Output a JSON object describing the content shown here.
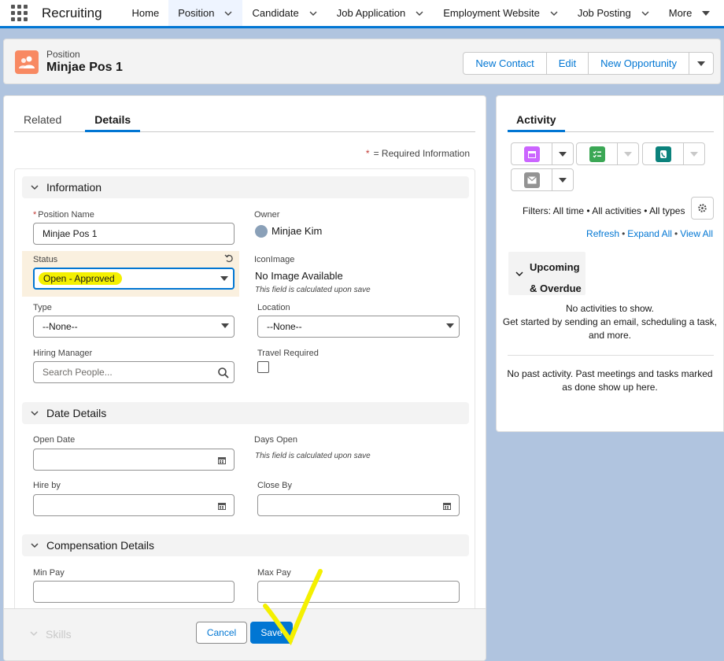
{
  "app": {
    "name": "Recruiting",
    "nav": [
      {
        "label": "Home",
        "dropdown": false
      },
      {
        "label": "Position",
        "dropdown": true,
        "active": true
      },
      {
        "label": "Candidate",
        "dropdown": true
      },
      {
        "label": "Job Application",
        "dropdown": true
      },
      {
        "label": "Employment Website",
        "dropdown": true
      },
      {
        "label": "Job Posting",
        "dropdown": true
      },
      {
        "label": "More",
        "dropdown": true
      }
    ]
  },
  "record": {
    "type": "Position",
    "title": "Minjae Pos 1",
    "actions": [
      "New Contact",
      "Edit",
      "New Opportunity"
    ]
  },
  "tabs": {
    "related": "Related",
    "details": "Details"
  },
  "required_info": "= Required Information",
  "sections": {
    "information": "Information",
    "date_details": "Date Details",
    "compensation": "Compensation Details",
    "skills": "Skills"
  },
  "fields": {
    "position_name": {
      "label": "Position Name",
      "value": "Minjae Pos 1"
    },
    "owner": {
      "label": "Owner",
      "value": "Minjae Kim"
    },
    "status": {
      "label": "Status",
      "value": "Open - Approved"
    },
    "icon_image": {
      "label": "IconImage",
      "value": "No Image Available",
      "note": "This field is calculated upon save"
    },
    "type": {
      "label": "Type",
      "value": "--None--"
    },
    "location": {
      "label": "Location",
      "value": "--None--"
    },
    "hiring_manager": {
      "label": "Hiring Manager",
      "placeholder": "Search People..."
    },
    "travel_required": {
      "label": "Travel Required",
      "checked": false
    },
    "open_date": {
      "label": "Open Date",
      "value": ""
    },
    "days_open": {
      "label": "Days Open",
      "note": "This field is calculated upon save"
    },
    "hire_by": {
      "label": "Hire by",
      "value": ""
    },
    "close_by": {
      "label": "Close By",
      "value": ""
    },
    "min_pay": {
      "label": "Min Pay",
      "value": ""
    },
    "max_pay": {
      "label": "Max Pay",
      "value": ""
    }
  },
  "footer": {
    "cancel": "Cancel",
    "save": "Save"
  },
  "activity": {
    "tab": "Activity",
    "filters": "Filters: All time • All activities • All types",
    "links": [
      "Refresh",
      "Expand All",
      "View All"
    ],
    "upcoming_l1": "Upcoming",
    "upcoming_l2": "& Overdue",
    "no_activities_l1": "No activities to show.",
    "no_activities_l2": "Get started by sending an email, scheduling a task,",
    "no_activities_l3": "and more.",
    "no_past_l1": "No past activity. Past meetings and tasks marked",
    "no_past_l2": "as done show up here."
  },
  "colors": {
    "brand": "#0176d3",
    "record_icon": "#f88962",
    "highlight": "#f4f000",
    "event": "#cb65ff",
    "task": "#3ba755",
    "call": "#0b827c",
    "email": "#939393"
  }
}
